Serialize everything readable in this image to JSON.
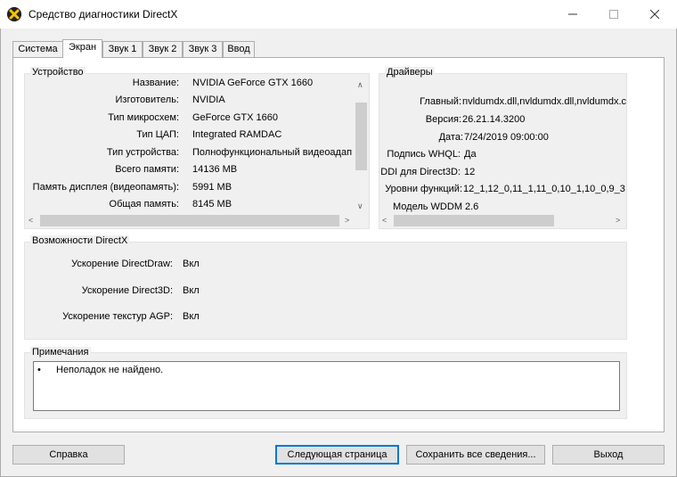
{
  "window": {
    "title": "Средство диагностики DirectX",
    "icon": "directx-x-icon"
  },
  "tabs": [
    {
      "label": "Система"
    },
    {
      "label": "Экран"
    },
    {
      "label": "Звук 1"
    },
    {
      "label": "Звук 2"
    },
    {
      "label": "Звук 3"
    },
    {
      "label": "Ввод"
    }
  ],
  "device": {
    "title": "Устройство",
    "rows": [
      {
        "label": "Название:",
        "value": "NVIDIA GeForce GTX 1660"
      },
      {
        "label": "Изготовитель:",
        "value": "NVIDIA"
      },
      {
        "label": "Тип микросхем:",
        "value": "GeForce GTX 1660"
      },
      {
        "label": "Тип ЦАП:",
        "value": "Integrated RAMDAC"
      },
      {
        "label": "Тип устройства:",
        "value": "Полнофункциональный видеоадап"
      },
      {
        "label": "Всего памяти:",
        "value": "14136 MB"
      },
      {
        "label": "Память дисплея (видеопамять):",
        "value": "5991 MB"
      },
      {
        "label": "Общая память:",
        "value": "8145 MB"
      }
    ]
  },
  "drivers": {
    "title": "Драйверы",
    "rows": [
      {
        "label": "Главный:",
        "value": "nvldumdx.dll,nvldumdx.dll,nvldumdx.c"
      },
      {
        "label": "Версия:",
        "value": "26.21.14.3200"
      },
      {
        "label": "Дата:",
        "value": "7/24/2019 09:00:00"
      },
      {
        "label": "Подпись WHQL:",
        "value": "Да"
      },
      {
        "label": "DDI для Direct3D:",
        "value": "12"
      },
      {
        "label": "Уровни функций:",
        "value": "12_1,12_0,11_1,11_0,10_1,10_0,9_3"
      },
      {
        "label": "Модель WDDM",
        "value": "2.6"
      }
    ]
  },
  "directx": {
    "title": "Возможности DirectX",
    "rows": [
      {
        "label": "Ускорение DirectDraw:",
        "value": "Вкл"
      },
      {
        "label": "Ускорение Direct3D:",
        "value": "Вкл"
      },
      {
        "label": "Ускорение текстур AGP:",
        "value": "Вкл"
      }
    ]
  },
  "notes": {
    "title": "Примечания",
    "items": [
      "Неполадок не найдено."
    ]
  },
  "buttons": {
    "help": "Справка",
    "next": "Следующая страница",
    "save": "Сохранить все сведения...",
    "exit": "Выход"
  }
}
